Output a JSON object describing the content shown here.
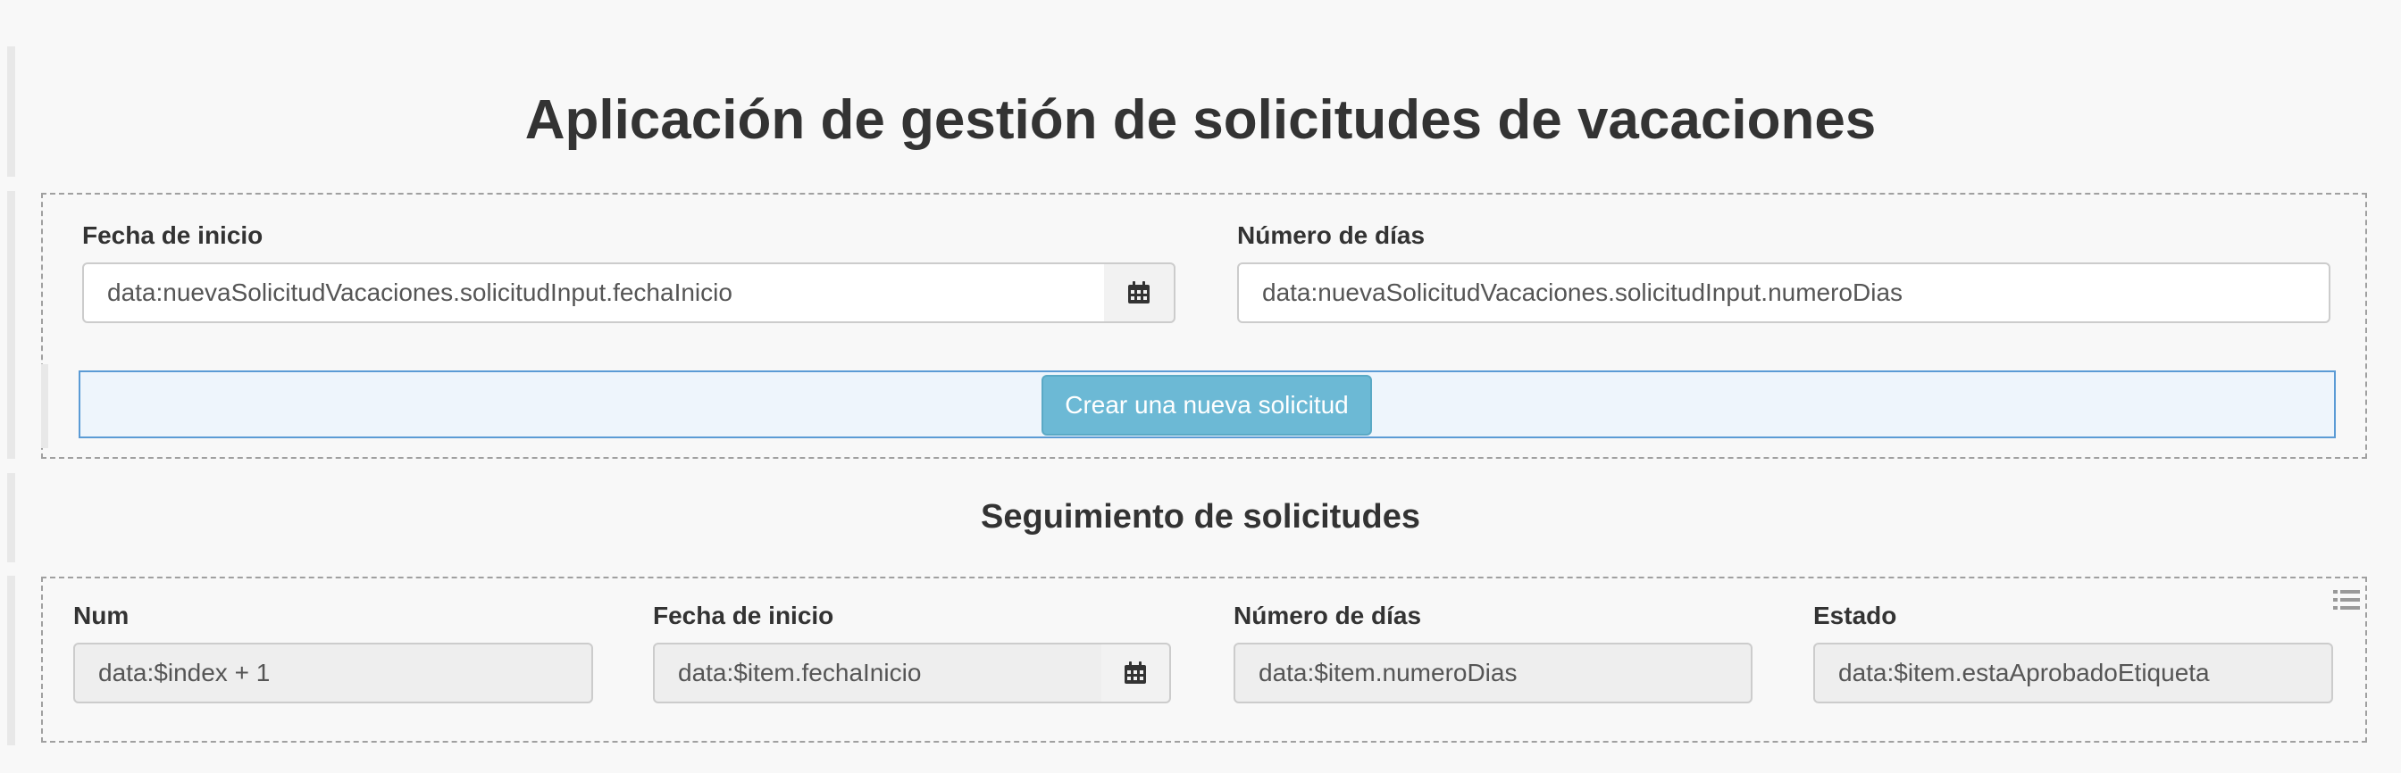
{
  "header": {
    "title": "Aplicación de gestión de solicitudes de vacaciones"
  },
  "form": {
    "start_date_label": "Fecha de inicio",
    "start_date_value": "data:nuevaSolicitudVacaciones.solicitudInput.fechaInicio",
    "days_label": "Número de días",
    "days_value": "data:nuevaSolicitudVacaciones.solicitudInput.numeroDias",
    "submit_label": "Crear una nueva solicitud",
    "calendar_icon": "calendar-icon"
  },
  "tracking": {
    "title": "Seguimiento de solicitudes",
    "list_icon": "list-icon",
    "columns": [
      {
        "label": "Num",
        "value": "data:$index + 1"
      },
      {
        "label": "Fecha de inicio",
        "value": "data:$item.fechaInicio"
      },
      {
        "label": "Número de días",
        "value": "data:$item.numeroDias"
      },
      {
        "label": "Estado",
        "value": "data:$item.estaAprobadoEtiqueta"
      }
    ]
  },
  "colors": {
    "background": "#f8f8f8",
    "button_bg": "#6cb9d5",
    "button_bar_border": "#5b9bd5",
    "button_bar_bg": "#eef5fc",
    "readonly_bg": "#eeeeee"
  }
}
